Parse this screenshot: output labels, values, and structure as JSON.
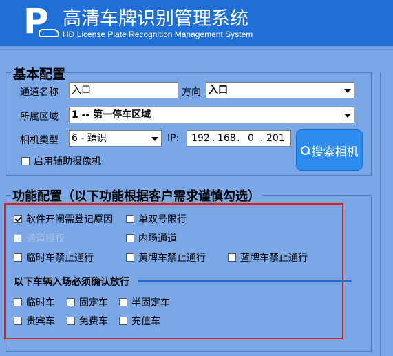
{
  "header": {
    "logo_letter": "P",
    "title_cn": "高清车牌识别管理系统",
    "title_en": "HD License Plate Recognition Management System"
  },
  "basic": {
    "legend": "基本配置",
    "channel_name_label": "通道名称",
    "channel_name_value": "入口",
    "direction_label": "方向",
    "direction_value": "入口",
    "area_label": "所属区域",
    "area_value": "1 -- 第一停车区域",
    "camera_type_label": "相机类型",
    "camera_type_value": "6 -  臻识",
    "ip_label": "IP:",
    "ip": [
      "192",
      "168",
      "0",
      "201"
    ],
    "aux_camera_label": "启用辅助摄像机",
    "search_button": "搜索相机"
  },
  "function": {
    "legend": "功能配置（以下功能根据客户需求谨慎勾选）",
    "options": [
      {
        "label": "软件开闸需登记原因",
        "checked": true
      },
      {
        "label": "单双号限行",
        "checked": false
      },
      {
        "label": "通道授权",
        "checked": false,
        "disabled": true
      },
      {
        "label": "内场通道",
        "checked": false
      },
      {
        "label": "临时车禁止通行",
        "checked": false
      },
      {
        "label": "黄牌车禁止通行",
        "checked": false
      },
      {
        "label": "蓝牌车禁止通行",
        "checked": false
      }
    ],
    "confirm_heading": "以下车辆入场必须确认放行",
    "confirm_options": [
      {
        "label": "临时车",
        "checked": false
      },
      {
        "label": "固定车",
        "checked": false
      },
      {
        "label": "半固定车",
        "checked": false
      },
      {
        "label": "贵宾车",
        "checked": false
      },
      {
        "label": "免费车",
        "checked": false
      },
      {
        "label": "充值车",
        "checked": false
      }
    ]
  }
}
